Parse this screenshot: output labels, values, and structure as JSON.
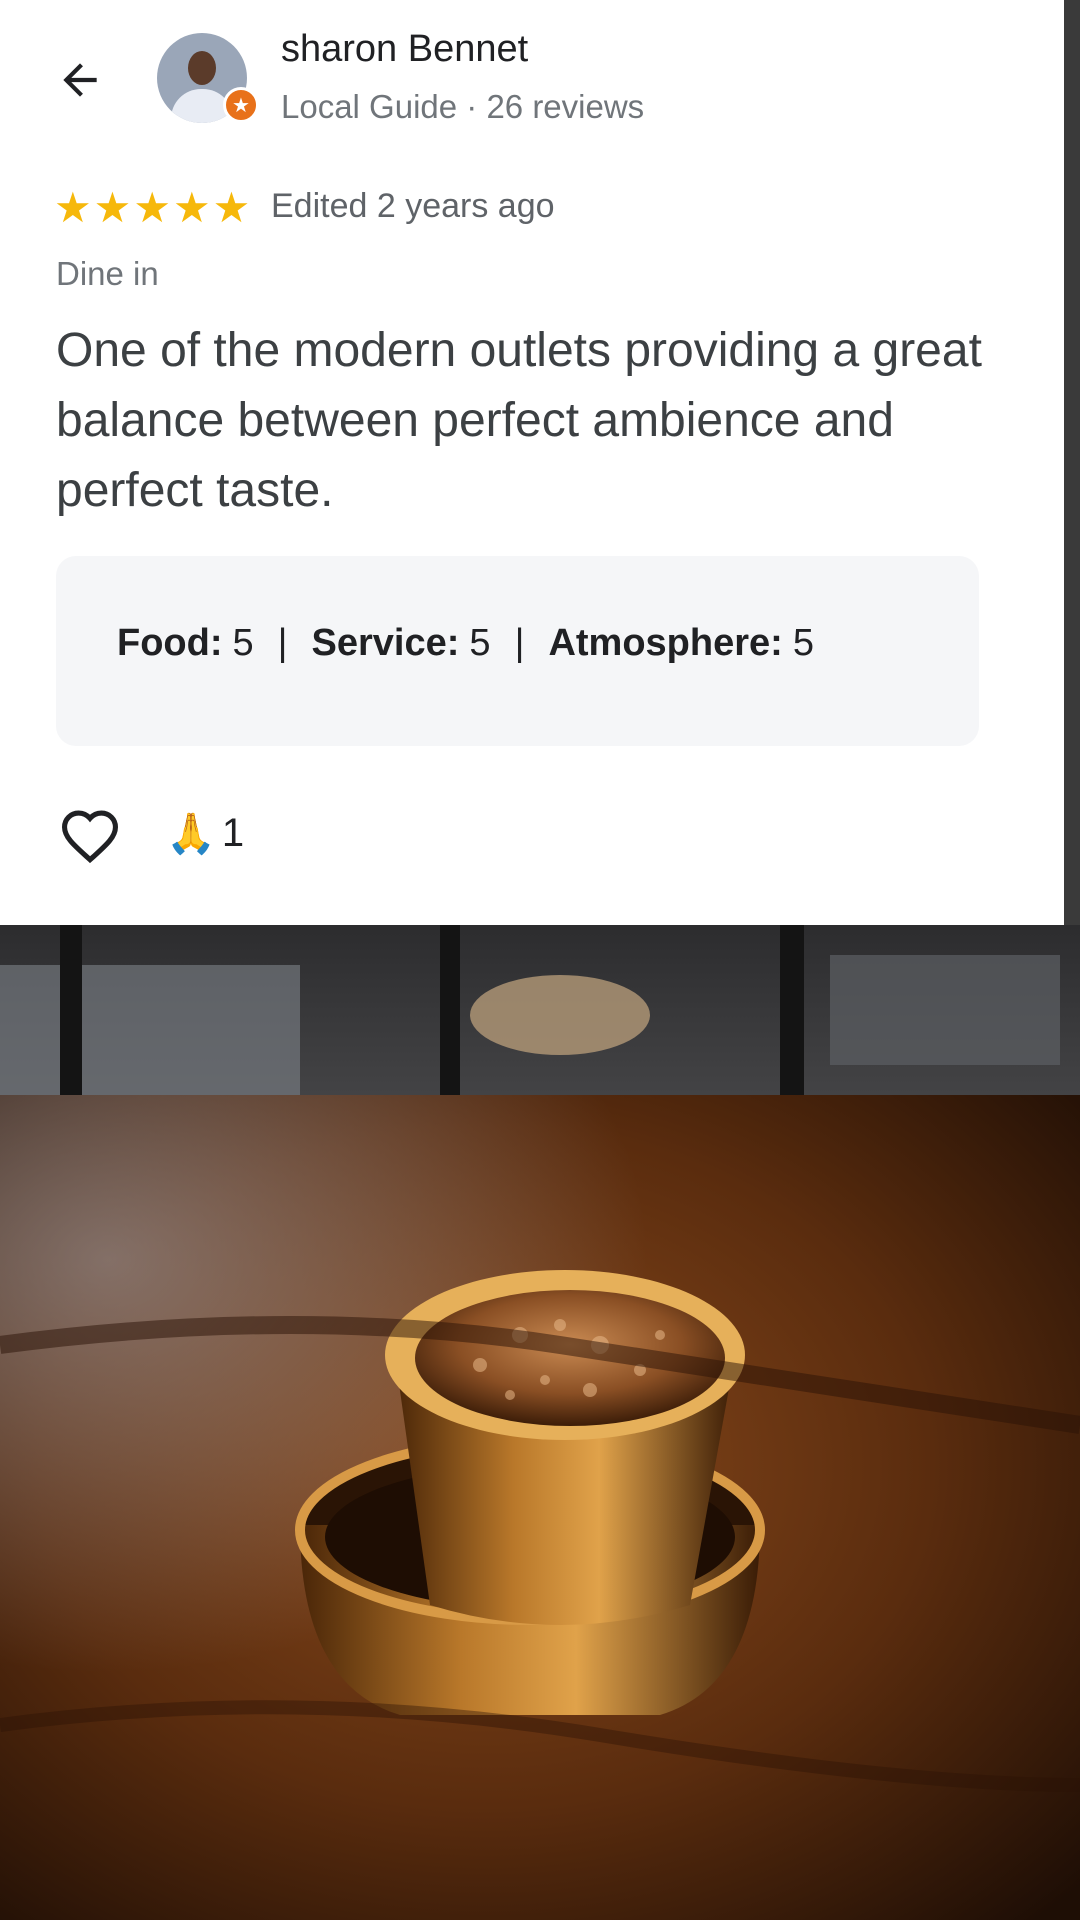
{
  "header": {
    "user_name": "sharon Bennet",
    "user_meta": "Local Guide · 26 reviews"
  },
  "review": {
    "rating": 5,
    "rating_max": 5,
    "edited": "Edited 2 years ago",
    "dine_type": "Dine in",
    "text": "One of the modern outlets providing a great balance between perfect ambience and perfect taste."
  },
  "ratings": {
    "food_label": "Food:",
    "food_value": "5",
    "service_label": "Service:",
    "service_value": "5",
    "atmosphere_label": "Atmosphere:",
    "atmosphere_value": "5",
    "separator": "|"
  },
  "reactions": {
    "emoji": "🙏",
    "count": "1"
  },
  "icons": {
    "back": "arrow-left-icon",
    "like": "heart-outline-icon",
    "guide": "local-guide-star-icon"
  },
  "colors": {
    "star": "#f6b80b",
    "guide_badge": "#e8711a",
    "ratings_bg": "#f5f6f8"
  }
}
